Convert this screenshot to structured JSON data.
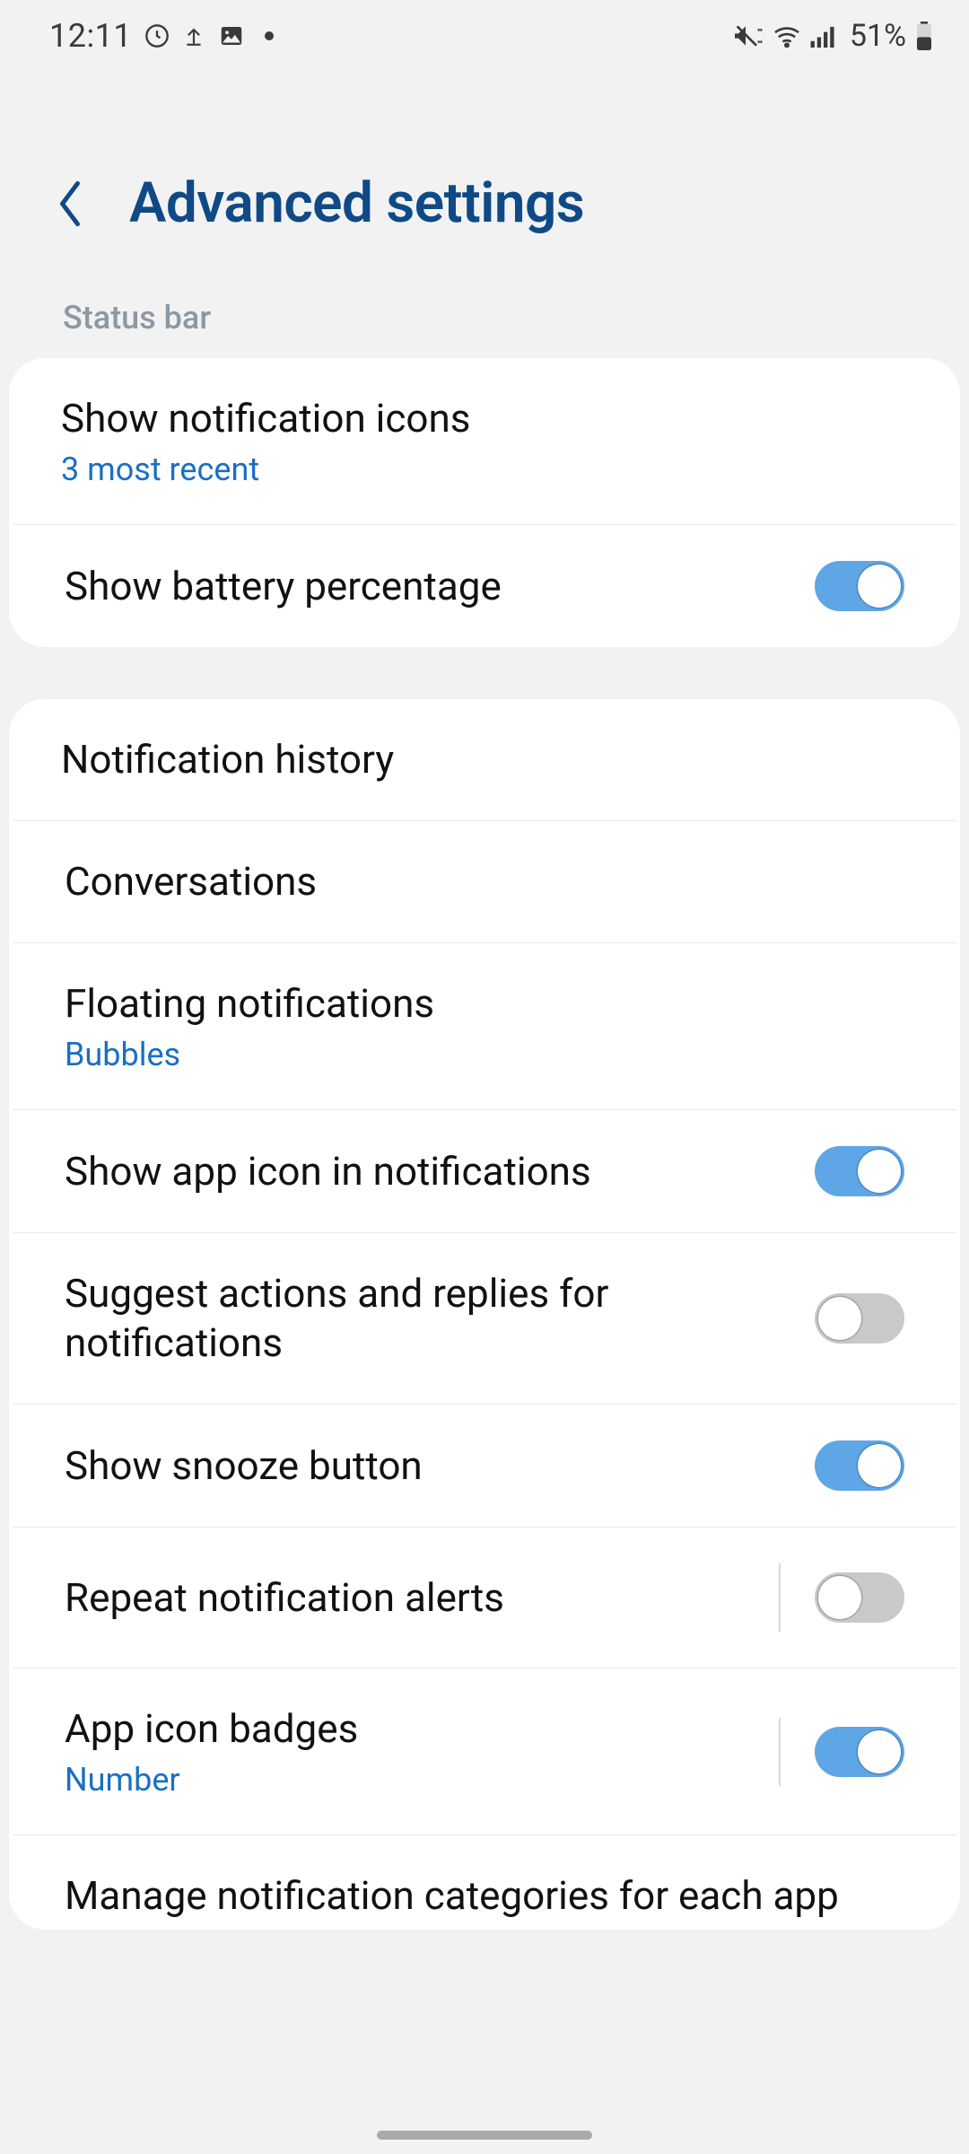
{
  "status_bar": {
    "time": "12:11",
    "battery_text": "51%"
  },
  "header": {
    "title": "Advanced settings"
  },
  "sections": {
    "status_bar_label": "Status bar"
  },
  "group1": {
    "notif_icons": {
      "title": "Show notification icons",
      "sub": "3 most recent"
    },
    "battery_pct": {
      "title": "Show battery percentage",
      "on": true
    }
  },
  "group2": {
    "history": {
      "title": "Notification history"
    },
    "conversations": {
      "title": "Conversations"
    },
    "floating": {
      "title": "Floating notifications",
      "sub": "Bubbles"
    },
    "app_icon": {
      "title": "Show app icon in notifications",
      "on": true
    },
    "suggest": {
      "title": "Suggest actions and replies for notifications",
      "on": false
    },
    "snooze": {
      "title": "Show snooze button",
      "on": true
    },
    "repeat": {
      "title": "Repeat notification alerts",
      "on": false,
      "divider": true
    },
    "badges": {
      "title": "App icon badges",
      "sub": "Number",
      "on": true,
      "divider": true
    },
    "categories": {
      "title": "Manage notification categories for each app"
    }
  }
}
